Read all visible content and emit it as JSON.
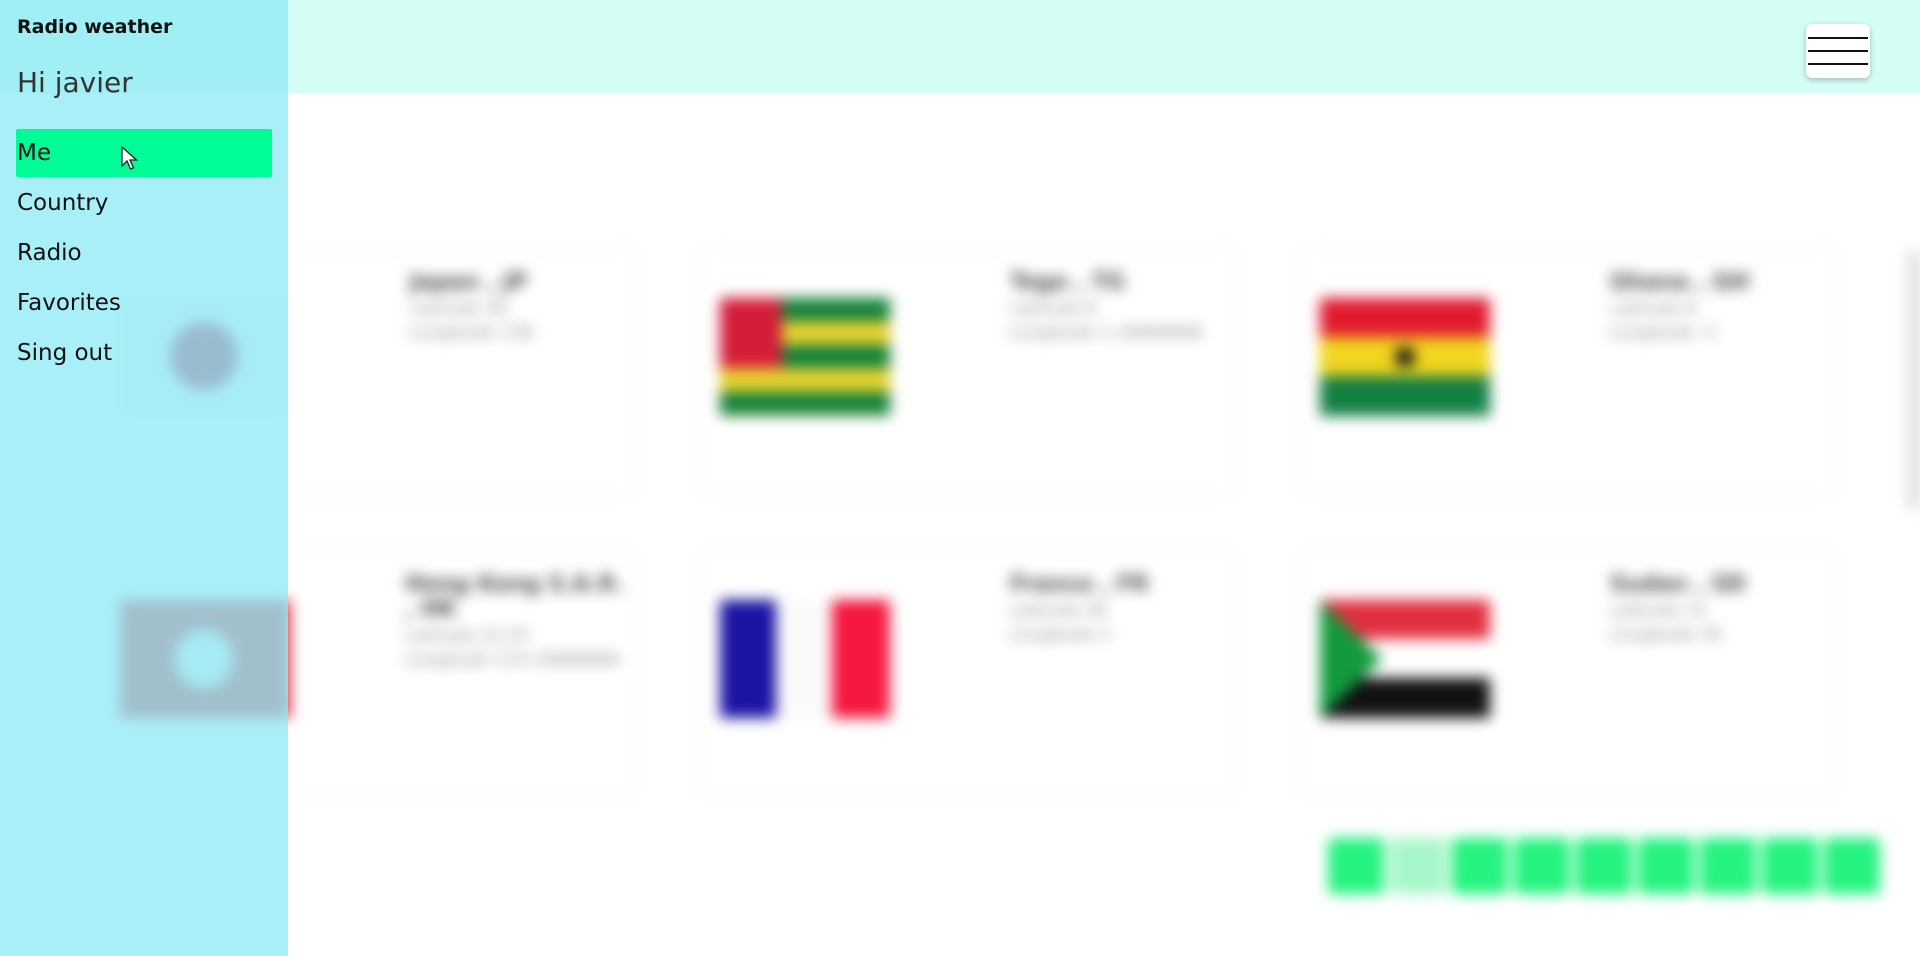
{
  "sidebar": {
    "app_title": "Radio weather",
    "greeting": "Hi javier",
    "items": [
      {
        "label": "Me",
        "active": true
      },
      {
        "label": "Country",
        "active": false
      },
      {
        "label": "Radio",
        "active": false
      },
      {
        "label": "Favorites",
        "active": false
      },
      {
        "label": "Sing out",
        "active": false
      }
    ]
  },
  "header": {
    "menu_icon": "hamburger-menu-icon"
  },
  "countries": [
    {
      "name": "Japan , JP",
      "lat": "Latitude 36",
      "lng": "Longitude 138",
      "flag": "japan"
    },
    {
      "name": "Togo , TG",
      "lat": "Latitude 8",
      "lng": "Longitude 1.16666666",
      "flag": "togo"
    },
    {
      "name": "Ghana , GH",
      "lat": "Latitude 8",
      "lng": "Longitude -2",
      "flag": "ghana"
    },
    {
      "name": "Hong Kong S.A.R. , HK",
      "lat": "Latitude 22.25",
      "lng": "Longitude 114.16666666",
      "flag": "hk"
    },
    {
      "name": "France , FR",
      "lat": "Latitude 46",
      "lng": "Longitude 2",
      "flag": "france"
    },
    {
      "name": "Sudan , SD",
      "lat": "Latitude 15",
      "lng": "Longitude 30",
      "flag": "sudan"
    }
  ],
  "pagination": {
    "current": 2,
    "count": 9
  },
  "colors": {
    "sidebar": "#91eaf5",
    "active_item": "#00fc96",
    "topbar": "#d3fdf5",
    "pager": "#24f37f"
  }
}
